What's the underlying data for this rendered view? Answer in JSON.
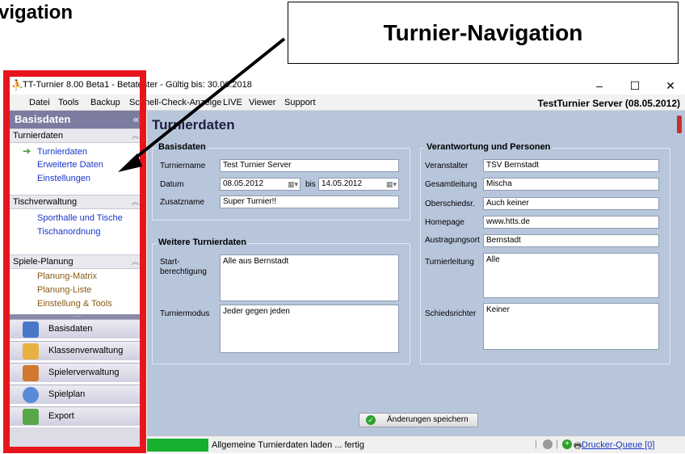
{
  "annotation": {
    "top_left_fragment": "vigation",
    "box_label": "Turnier-Navigation"
  },
  "window": {
    "title": "TT-Turnier 8.00 Beta1 - Betatester - Gültig bis: 30.06.2018",
    "minimize": "–",
    "maximize": "☐",
    "close": "✕"
  },
  "menu": {
    "items": [
      "Datei",
      "Tools",
      "Backup",
      "Schnell-Check-Anzeige",
      "LIVE",
      "Viewer",
      "Support"
    ],
    "server": "TestTurnier Server (08.05.2012)"
  },
  "sidebar": {
    "header": "Basisdaten",
    "collapse_glyph": "«",
    "groups": [
      {
        "label": "Turnierdaten",
        "items": [
          "Turnierdaten",
          "Erweiterte Daten",
          "Einstellungen"
        ]
      },
      {
        "label": "Tischverwaltung",
        "items": [
          "Sporthalle und Tische",
          "Tischanordnung"
        ]
      },
      {
        "label": "Spiele-Planung",
        "items": [
          "Planung-Matrix",
          "Planung-Liste",
          "Einstellung & Tools"
        ]
      }
    ],
    "dots": "·····",
    "nav_buttons": [
      "Basisdaten",
      "Klassenverwaltung",
      "Spielerverwaltung",
      "Spielplan",
      "Export"
    ]
  },
  "main": {
    "title": "Turnierdaten",
    "basisdaten": {
      "group_title": "Basisdaten",
      "turniername_label": "Turniername",
      "turniername": "Test Turnier Server",
      "datum_label": "Datum",
      "datum_von": "08.05.2012",
      "bis_label": "bis",
      "datum_bis": "14.05.2012",
      "zusatzname_label": "Zusatzname",
      "zusatzname": "Super Turnier!!"
    },
    "weitere": {
      "group_title": "Weitere Turnierdaten",
      "start_label_1": "Start-",
      "start_label_2": "berechtigung",
      "start_value": "Alle aus Bernstadt",
      "modus_label": "Turniermodus",
      "modus_value": "Jeder gegen jeden"
    },
    "verantwortung": {
      "group_title": "Verantwortung und Personen",
      "veranstalter_label": "Veranstalter",
      "veranstalter": "TSV Bernstadt",
      "gesamtleitung_label": "Gesamtleitung",
      "gesamtleitung": "Mischa",
      "oberschiedsr_label": "Oberschiedsr.",
      "oberschiedsr": "Auch keiner",
      "homepage_label": "Homepage",
      "homepage": "www.htts.de",
      "austragungsort_label": "Austragungsort",
      "austragungsort": "Bernstadt",
      "turnierleitung_label": "Turnierleitung",
      "turnierleitung": "Alle",
      "schiedsrichter_label": "Schiedsrichter",
      "schiedsrichter": "Keiner"
    },
    "save_button": "Änderungen speichern"
  },
  "status": {
    "progress_fraction": 1.0,
    "text": "Allgemeine Turnierdaten laden ... fertig",
    "queue": "Drucker-Queue [0]"
  },
  "colors": {
    "red_frame": "#e8141c",
    "panel_bg": "#b8c6dc",
    "sidebar_header": "#7c7ca0",
    "link_blue": "#1a36c8",
    "link_brown": "#8a5a10",
    "progress_green": "#17b02f"
  }
}
